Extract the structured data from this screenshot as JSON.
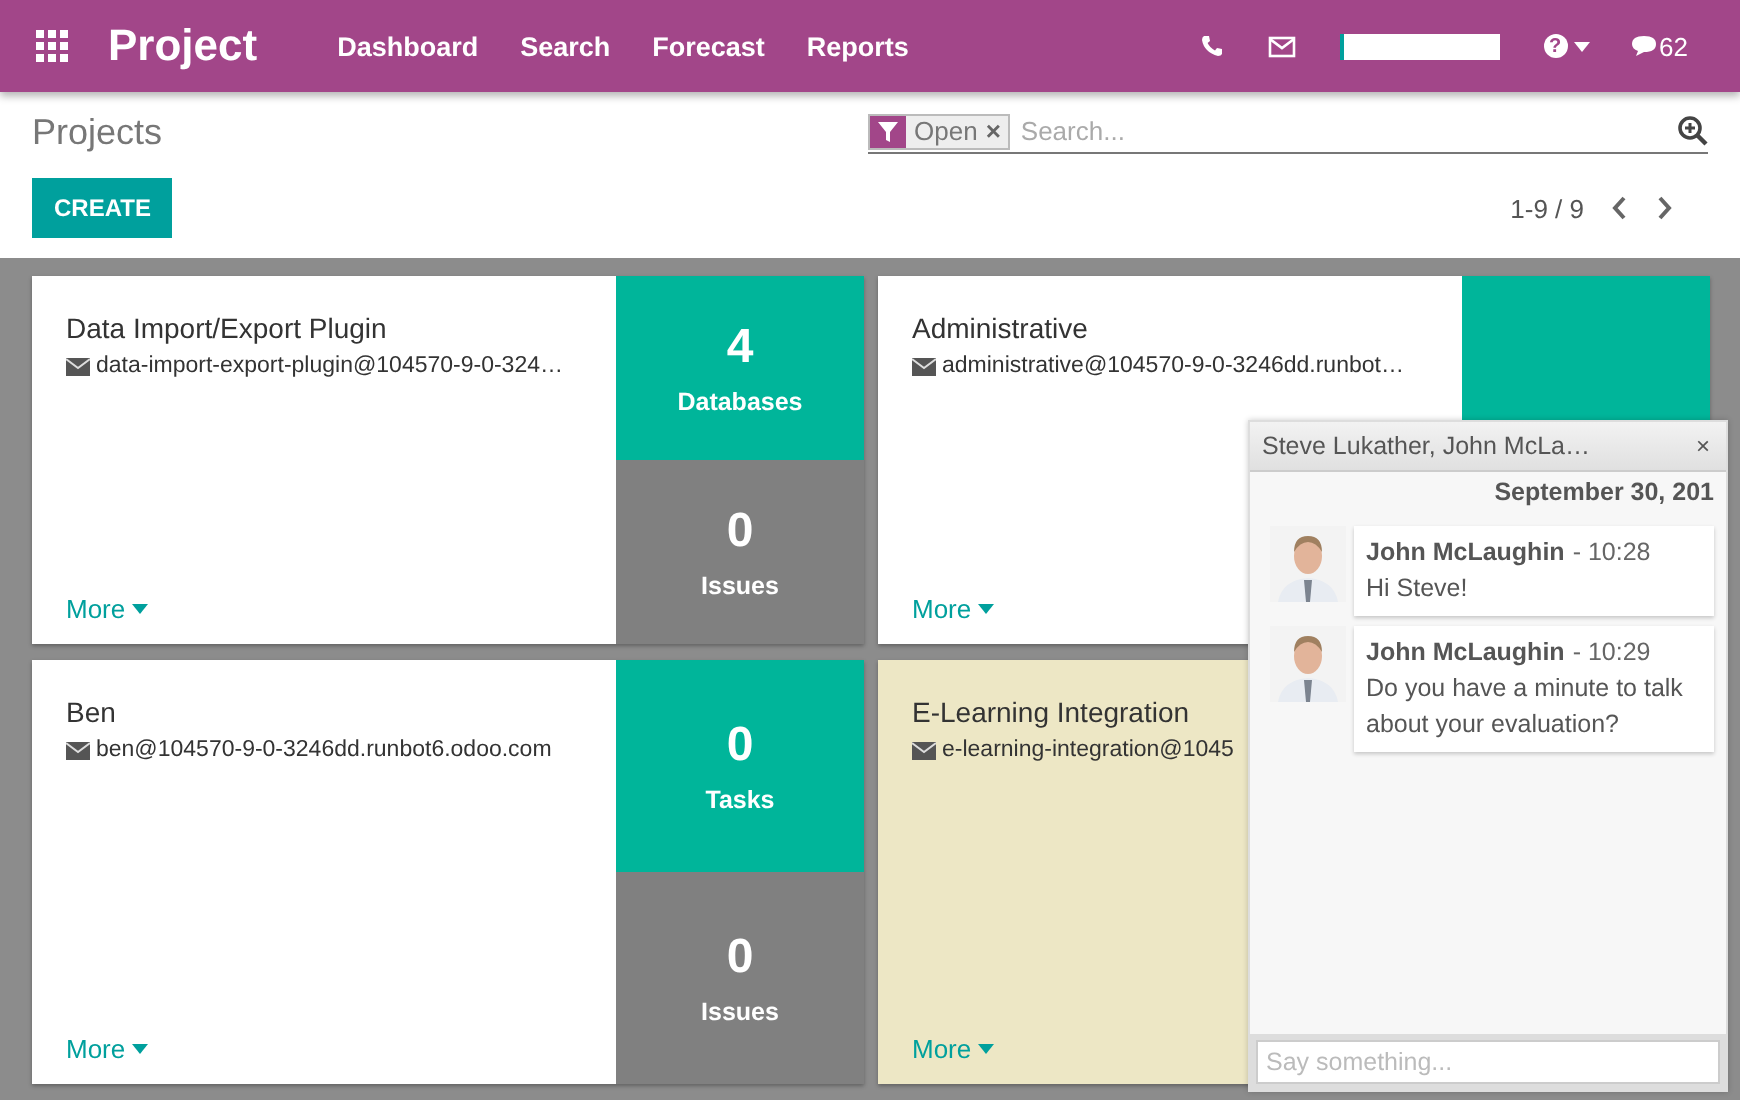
{
  "navbar": {
    "app_title": "Project",
    "menu": [
      "Dashboard",
      "Search",
      "Forecast",
      "Reports"
    ],
    "progress": {
      "level": 0.03
    },
    "help": "?",
    "messages_count": "62"
  },
  "control_panel": {
    "breadcrumb": "Projects",
    "facet": "Open",
    "facet_remove": "×",
    "search_placeholder": "Search...",
    "create": "CREATE",
    "pager": "1-9 / 9"
  },
  "projects": [
    {
      "name": "Data Import/Export Plugin",
      "email": "data-import-export-plugin@104570-9-0-324…",
      "color": "#ffffff",
      "more": "More",
      "tiles": [
        {
          "kind": "primary",
          "value": "4",
          "label": "Databases"
        },
        {
          "kind": "secondary",
          "value": "0",
          "label": "Issues"
        }
      ]
    },
    {
      "name": "Administrative",
      "email": "administrative@104570-9-0-3246dd.runbot…",
      "color": "#ffffff",
      "more": "More",
      "tiles": [
        {
          "kind": "primary"
        }
      ]
    },
    {
      "name": "Ben",
      "email": "ben@104570-9-0-3246dd.runbot6.odoo.com",
      "color": "#ffffff",
      "more": "More",
      "tiles": [
        {
          "kind": "primary",
          "value": "0",
          "label": "Tasks"
        },
        {
          "kind": "secondary",
          "value": "0",
          "label": "Issues"
        }
      ]
    },
    {
      "name": "E-Learning Integration",
      "email": "e-learning-integration@1045",
      "color": "#ede7c5",
      "more": "More"
    }
  ],
  "chat": {
    "title": "Steve Lukather, John McLa…",
    "close": "×",
    "date": "September 30, 201",
    "messages": [
      {
        "author": "John McLaughin",
        "time": "- 10:28",
        "text": "Hi Steve!"
      },
      {
        "author": "John McLaughin",
        "time": "- 10:29",
        "text": "Do you have a minute to talk about your evaluation?"
      }
    ],
    "placeholder": "Say something..."
  }
}
